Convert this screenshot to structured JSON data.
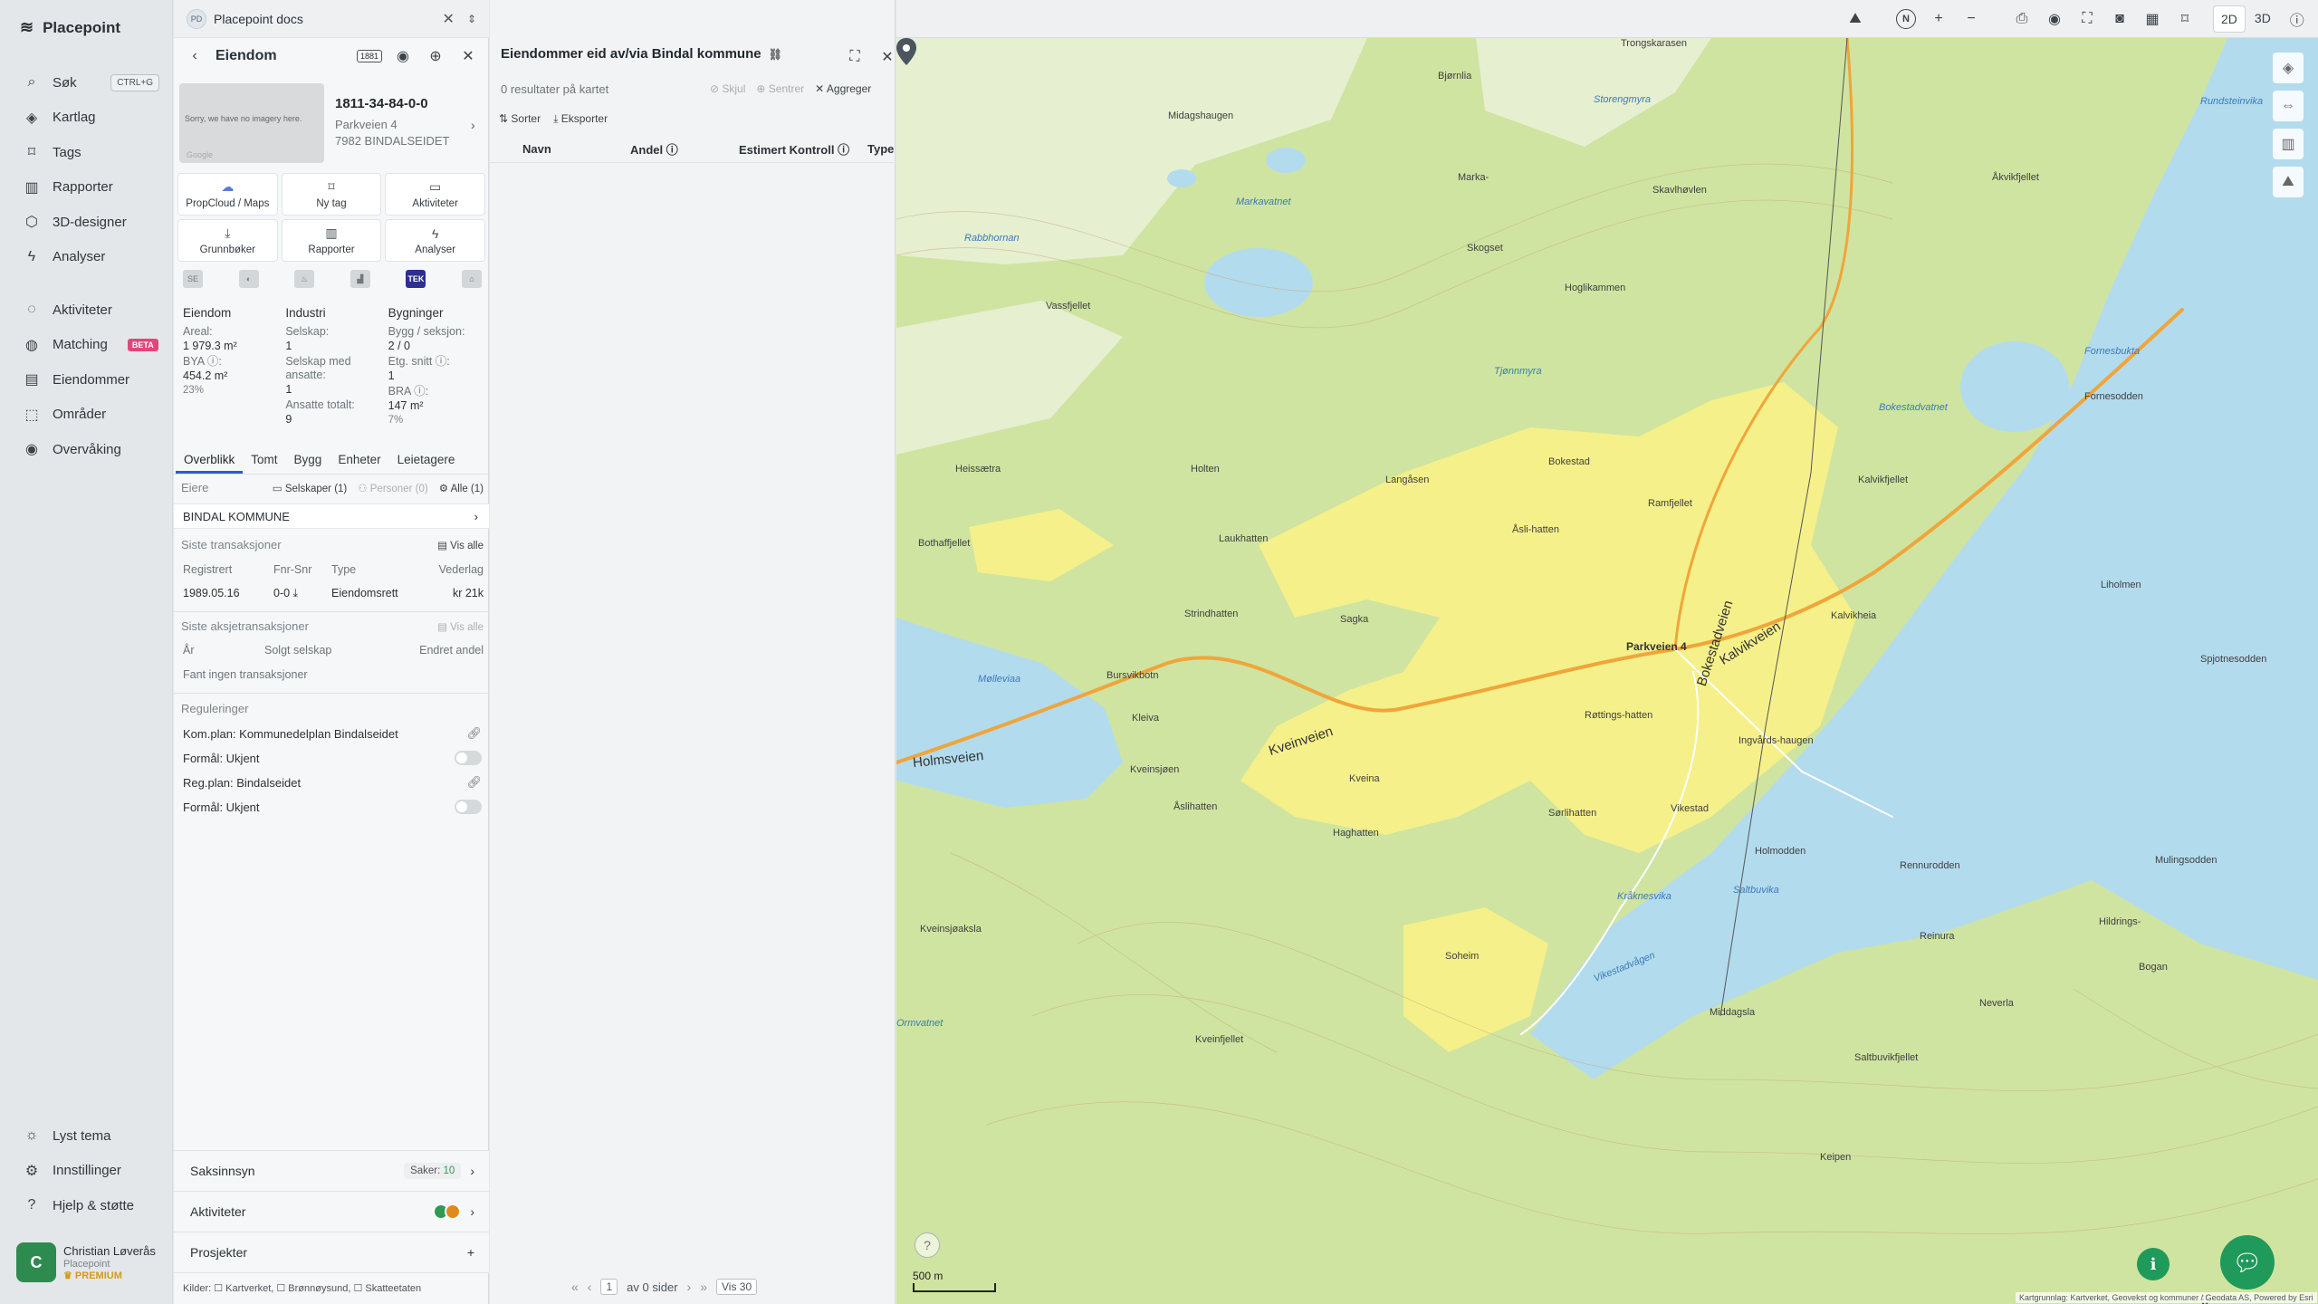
{
  "app": {
    "brand": "Placepoint"
  },
  "nav": {
    "items": [
      {
        "label": "Søk",
        "icon": "⌕",
        "shortcut": "CTRL+G"
      },
      {
        "label": "Kartlag",
        "icon": "◈"
      },
      {
        "label": "Tags",
        "icon": "⌑"
      },
      {
        "label": "Rapporter",
        "icon": "▥"
      },
      {
        "label": "3D-designer",
        "icon": "⬡"
      },
      {
        "label": "Analyser",
        "icon": "ϟ"
      }
    ],
    "items2": [
      {
        "label": "Aktiviteter",
        "icon": "◌"
      },
      {
        "label": "Matching",
        "icon": "◍",
        "badge": "BETA"
      },
      {
        "label": "Eiendommer",
        "icon": "▤"
      },
      {
        "label": "Områder",
        "icon": "⬚"
      },
      {
        "label": "Overvåking",
        "icon": "◉"
      }
    ],
    "bottom": [
      {
        "label": "Lyst tema",
        "icon": "☼"
      },
      {
        "label": "Innstillinger",
        "icon": "⚙"
      },
      {
        "label": "Hjelp & støtte",
        "icon": "?"
      }
    ],
    "user": {
      "initial": "C",
      "name": "Christian Løverås",
      "org": "Placepoint",
      "plan": "PREMIUM"
    }
  },
  "workspace": {
    "badge": "PD",
    "title": "Placepoint docs"
  },
  "property": {
    "header": "Eiendom",
    "badge": "1881",
    "thumb_text": "Sorry, we have no imagery here.",
    "thumb_google": "Google",
    "id": "1811-34-84-0-0",
    "address": "Parkveien 4",
    "postal": "7982 BINDALSEIDET",
    "tiles": [
      {
        "icon": "☁",
        "label": "PropCloud / Maps"
      },
      {
        "icon": "⌑",
        "label": "Ny tag"
      },
      {
        "icon": "▭",
        "label": "Aktiviteter"
      },
      {
        "icon": "⤓",
        "label": "Grunnbøker"
      },
      {
        "icon": "▥",
        "label": "Rapporter"
      },
      {
        "icon": "ϟ",
        "label": "Analyser"
      }
    ],
    "sources": [
      "SE",
      "◐",
      "♨",
      "▟",
      "TEK",
      "⌂"
    ],
    "stats": {
      "c1": {
        "h": "Eiendom",
        "l1": "Areal:",
        "v1": "1 979.3 m²",
        "l2": "BYA ⓘ:",
        "v2": "454.2 m²",
        "p2": "23%"
      },
      "c2": {
        "h": "Industri",
        "l1": "Selskap:",
        "v1": "1",
        "l2": "Selskap med ansatte:",
        "v2": "1",
        "l3": "Ansatte totalt:",
        "v3": "9"
      },
      "c3": {
        "h": "Bygninger",
        "l1": "Bygg / seksjon:",
        "v1": "2 / 0",
        "l2": "Etg. snitt ⓘ:",
        "v2": "1",
        "l3": "BRA ⓘ:",
        "v3": "147 m²",
        "p3": "7%"
      }
    },
    "tabs": [
      "Overblikk",
      "Tomt",
      "Bygg",
      "Enheter",
      "Leietagere"
    ],
    "owners": {
      "label": "Eiere",
      "chip1": "Selskaper (1)",
      "chip2": "Personer (0)",
      "chip3": "Alle (1)",
      "owner": "BINDAL KOMMUNE"
    },
    "transactions": {
      "label": "Siste transaksjoner",
      "see_all": "Vis alle",
      "cols": [
        "Registrert",
        "Fnr-Snr",
        "Type",
        "Vederlag"
      ],
      "row": [
        "1989.05.16",
        "0-0 ⤓",
        "Eiendomsrett",
        "kr 21k"
      ]
    },
    "share_tx": {
      "label": "Siste aksjetransaksjoner",
      "see_all": "Vis alle",
      "cols": [
        "År",
        "Solgt selskap",
        "Endret andel"
      ],
      "empty": "Fant ingen transaksjoner"
    },
    "regulations": {
      "label": "Reguleringer",
      "r1": "Kom.plan: Kommunedelplan Bindalseidet",
      "r2": "Formål: Ukjent",
      "r3": "Reg.plan: Bindalseidet",
      "r4": "Formål: Ukjent"
    },
    "accordions": {
      "a1": "Saksinnsyn",
      "a1_badge_label": "Saker:",
      "a1_badge_val": "10",
      "a2": "Aktiviteter",
      "a3": "Prosjekter"
    },
    "sources_footer": "Kilder: ☐ Kartverket, ☐ Brønnøysund, ☐ Skatteetaten"
  },
  "list": {
    "title": "Eiendommer eid av/via Bindal kommune",
    "count": "0 resultater på kartet",
    "actions": [
      "Skjul",
      "Sentrer",
      "Aggreger"
    ],
    "sort": "Sorter",
    "export": "Eksporter",
    "columns": [
      "Navn",
      "Andel ⓘ",
      "Estimert Kontroll ⓘ",
      "Type"
    ],
    "pager": {
      "page": "1",
      "of": "av 0 sider",
      "per": "Vis 30"
    }
  },
  "map": {
    "scale": "500 m",
    "attribution": "Kartgrunnlag: Kartverket, Geovekst og kommuner / Geodata AS, Powered by Esri",
    "marker_label": "Parkveien 4",
    "labels": [
      {
        "t": "Trongskarasen",
        "c": "land"
      },
      {
        "t": "Bjørnlia",
        "c": "land"
      },
      {
        "t": "Midagshaugen",
        "c": "land"
      },
      {
        "t": "Storengmyra",
        "c": "water"
      },
      {
        "t": "Rundsteinvika",
        "c": "water"
      },
      {
        "t": "Markavatnet",
        "c": "water"
      },
      {
        "t": "Marka-",
        "c": "land"
      },
      {
        "t": "Skogset",
        "c": "land"
      },
      {
        "t": "Skavlhøvlen",
        "c": "land"
      },
      {
        "t": "Åkvikfjellet",
        "c": "land"
      },
      {
        "t": "Rabbhornan",
        "c": "water"
      },
      {
        "t": "Hoglikammen",
        "c": "land"
      },
      {
        "t": "Vassfjellet",
        "c": "land"
      },
      {
        "t": "Heissætra",
        "c": "land"
      },
      {
        "t": "Holten",
        "c": "land"
      },
      {
        "t": "Langåsen",
        "c": "land"
      },
      {
        "t": "Bokestad",
        "c": "land"
      },
      {
        "t": "Ramfjellet",
        "c": "land"
      },
      {
        "t": "Kalvikfjellet",
        "c": "land"
      },
      {
        "t": "Fornesbukta",
        "c": "water"
      },
      {
        "t": "Fornesodden",
        "c": "land"
      },
      {
        "t": "Bokestadvatnet",
        "c": "water"
      },
      {
        "t": "Tjønnmyra",
        "c": "water"
      },
      {
        "t": "Bothaffjellet",
        "c": "land"
      },
      {
        "t": "Laukhatten",
        "c": "land"
      },
      {
        "t": "Åsli-hatten",
        "c": "land"
      },
      {
        "t": "Liholmen",
        "c": "land"
      },
      {
        "t": "Kalvikheia",
        "c": "land"
      },
      {
        "t": "Strindhatten",
        "c": "land"
      },
      {
        "t": "Sagka",
        "c": "land"
      },
      {
        "t": "Mølleviaa",
        "c": "water"
      },
      {
        "t": "Bursvikbotn",
        "c": "land"
      },
      {
        "t": "Kleiva",
        "c": "land"
      },
      {
        "t": "Røttings-hatten",
        "c": "land"
      },
      {
        "t": "Ingvårds-haugen",
        "c": "land"
      },
      {
        "t": "Spjotnesodden",
        "c": "land"
      },
      {
        "t": "Holmsveien",
        "c": "road"
      },
      {
        "t": "Kveinveien",
        "c": "road"
      },
      {
        "t": "Kalvikveien",
        "c": "road"
      },
      {
        "t": "Bokestadveien",
        "c": "road"
      },
      {
        "t": "Kveinsjøen",
        "c": "land"
      },
      {
        "t": "Kveina",
        "c": "land"
      },
      {
        "t": "Vikestad",
        "c": "land"
      },
      {
        "t": "Åslihatten",
        "c": "land"
      },
      {
        "t": "Haghatten",
        "c": "land"
      },
      {
        "t": "Sørlihatten",
        "c": "land"
      },
      {
        "t": "Holmodden",
        "c": "land"
      },
      {
        "t": "Rennurodden",
        "c": "land"
      },
      {
        "t": "Mulingsodden",
        "c": "land"
      },
      {
        "t": "Kråknesvika",
        "c": "water"
      },
      {
        "t": "Saltbuvika",
        "c": "water"
      },
      {
        "t": "Kveinsjøaksla",
        "c": "land"
      },
      {
        "t": "Soheim",
        "c": "land"
      },
      {
        "t": "Reinura",
        "c": "land"
      },
      {
        "t": "Hildrings-",
        "c": "land"
      },
      {
        "t": "Bogan",
        "c": "land"
      },
      {
        "t": "Vikestadvågen",
        "c": "water"
      },
      {
        "t": "Middagsla",
        "c": "land"
      },
      {
        "t": "Neverla",
        "c": "land"
      },
      {
        "t": "Kveinfjellet",
        "c": "land"
      },
      {
        "t": "Saltbuvikfjellet",
        "c": "land"
      },
      {
        "t": "Keipen",
        "c": "land"
      },
      {
        "t": "Ormvatnet",
        "c": "water"
      }
    ]
  },
  "colors": {
    "accent": "#2a5bd7",
    "green": "#1f9a5b",
    "beta": "#e2457c",
    "water": "#b3dbee",
    "forest": "#c9e29a",
    "farmland": "#f5f08a"
  }
}
